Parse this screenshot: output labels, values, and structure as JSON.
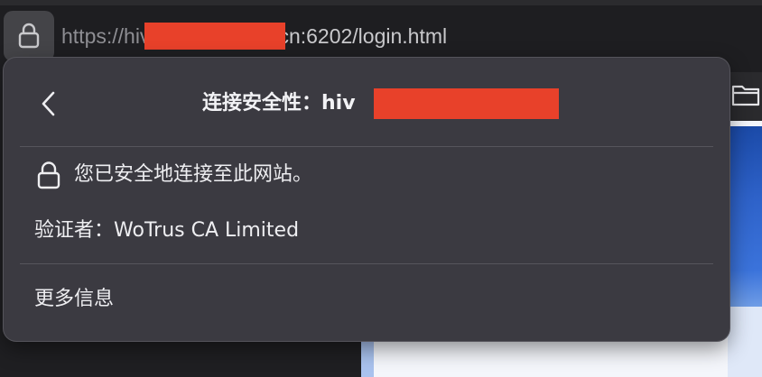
{
  "address_bar": {
    "url_prefix": "https://hiv",
    "url_suffix": "cn:6202/login.html",
    "lock_icon": "lock-icon"
  },
  "popover": {
    "back_icon": "chevron-left-icon",
    "title_label": "连接安全性：",
    "title_host": "hiv",
    "secure_icon": "lock-icon",
    "secure_text": "您已安全地连接至此网站。",
    "verifier_label": "验证者：",
    "verifier_value": "WoTrus CA Limited",
    "more_info": "更多信息"
  },
  "toolbar": {
    "folder_icon": "folder-icon"
  },
  "colors": {
    "popover_bg": "#3b3a41",
    "redaction": "#e8412a",
    "text": "#eeeef1",
    "url_text": "#8e8e93"
  }
}
